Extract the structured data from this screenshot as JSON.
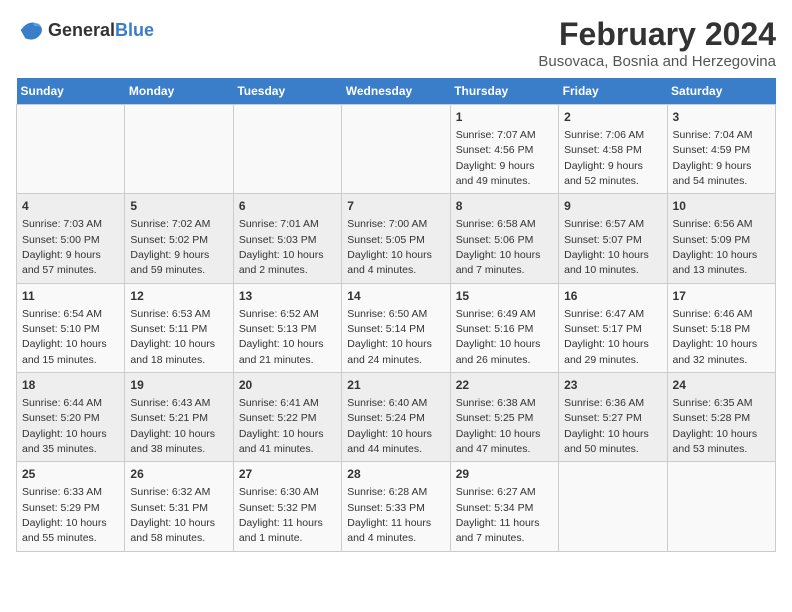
{
  "logo": {
    "general": "General",
    "blue": "Blue"
  },
  "title": "February 2024",
  "subtitle": "Busovaca, Bosnia and Herzegovina",
  "weekdays": [
    "Sunday",
    "Monday",
    "Tuesday",
    "Wednesday",
    "Thursday",
    "Friday",
    "Saturday"
  ],
  "weeks": [
    [
      {
        "day": "",
        "info": ""
      },
      {
        "day": "",
        "info": ""
      },
      {
        "day": "",
        "info": ""
      },
      {
        "day": "",
        "info": ""
      },
      {
        "day": "1",
        "info": "Sunrise: 7:07 AM\nSunset: 4:56 PM\nDaylight: 9 hours and 49 minutes."
      },
      {
        "day": "2",
        "info": "Sunrise: 7:06 AM\nSunset: 4:58 PM\nDaylight: 9 hours and 52 minutes."
      },
      {
        "day": "3",
        "info": "Sunrise: 7:04 AM\nSunset: 4:59 PM\nDaylight: 9 hours and 54 minutes."
      }
    ],
    [
      {
        "day": "4",
        "info": "Sunrise: 7:03 AM\nSunset: 5:00 PM\nDaylight: 9 hours and 57 minutes."
      },
      {
        "day": "5",
        "info": "Sunrise: 7:02 AM\nSunset: 5:02 PM\nDaylight: 9 hours and 59 minutes."
      },
      {
        "day": "6",
        "info": "Sunrise: 7:01 AM\nSunset: 5:03 PM\nDaylight: 10 hours and 2 minutes."
      },
      {
        "day": "7",
        "info": "Sunrise: 7:00 AM\nSunset: 5:05 PM\nDaylight: 10 hours and 4 minutes."
      },
      {
        "day": "8",
        "info": "Sunrise: 6:58 AM\nSunset: 5:06 PM\nDaylight: 10 hours and 7 minutes."
      },
      {
        "day": "9",
        "info": "Sunrise: 6:57 AM\nSunset: 5:07 PM\nDaylight: 10 hours and 10 minutes."
      },
      {
        "day": "10",
        "info": "Sunrise: 6:56 AM\nSunset: 5:09 PM\nDaylight: 10 hours and 13 minutes."
      }
    ],
    [
      {
        "day": "11",
        "info": "Sunrise: 6:54 AM\nSunset: 5:10 PM\nDaylight: 10 hours and 15 minutes."
      },
      {
        "day": "12",
        "info": "Sunrise: 6:53 AM\nSunset: 5:11 PM\nDaylight: 10 hours and 18 minutes."
      },
      {
        "day": "13",
        "info": "Sunrise: 6:52 AM\nSunset: 5:13 PM\nDaylight: 10 hours and 21 minutes."
      },
      {
        "day": "14",
        "info": "Sunrise: 6:50 AM\nSunset: 5:14 PM\nDaylight: 10 hours and 24 minutes."
      },
      {
        "day": "15",
        "info": "Sunrise: 6:49 AM\nSunset: 5:16 PM\nDaylight: 10 hours and 26 minutes."
      },
      {
        "day": "16",
        "info": "Sunrise: 6:47 AM\nSunset: 5:17 PM\nDaylight: 10 hours and 29 minutes."
      },
      {
        "day": "17",
        "info": "Sunrise: 6:46 AM\nSunset: 5:18 PM\nDaylight: 10 hours and 32 minutes."
      }
    ],
    [
      {
        "day": "18",
        "info": "Sunrise: 6:44 AM\nSunset: 5:20 PM\nDaylight: 10 hours and 35 minutes."
      },
      {
        "day": "19",
        "info": "Sunrise: 6:43 AM\nSunset: 5:21 PM\nDaylight: 10 hours and 38 minutes."
      },
      {
        "day": "20",
        "info": "Sunrise: 6:41 AM\nSunset: 5:22 PM\nDaylight: 10 hours and 41 minutes."
      },
      {
        "day": "21",
        "info": "Sunrise: 6:40 AM\nSunset: 5:24 PM\nDaylight: 10 hours and 44 minutes."
      },
      {
        "day": "22",
        "info": "Sunrise: 6:38 AM\nSunset: 5:25 PM\nDaylight: 10 hours and 47 minutes."
      },
      {
        "day": "23",
        "info": "Sunrise: 6:36 AM\nSunset: 5:27 PM\nDaylight: 10 hours and 50 minutes."
      },
      {
        "day": "24",
        "info": "Sunrise: 6:35 AM\nSunset: 5:28 PM\nDaylight: 10 hours and 53 minutes."
      }
    ],
    [
      {
        "day": "25",
        "info": "Sunrise: 6:33 AM\nSunset: 5:29 PM\nDaylight: 10 hours and 55 minutes."
      },
      {
        "day": "26",
        "info": "Sunrise: 6:32 AM\nSunset: 5:31 PM\nDaylight: 10 hours and 58 minutes."
      },
      {
        "day": "27",
        "info": "Sunrise: 6:30 AM\nSunset: 5:32 PM\nDaylight: 11 hours and 1 minute."
      },
      {
        "day": "28",
        "info": "Sunrise: 6:28 AM\nSunset: 5:33 PM\nDaylight: 11 hours and 4 minutes."
      },
      {
        "day": "29",
        "info": "Sunrise: 6:27 AM\nSunset: 5:34 PM\nDaylight: 11 hours and 7 minutes."
      },
      {
        "day": "",
        "info": ""
      },
      {
        "day": "",
        "info": ""
      }
    ]
  ]
}
